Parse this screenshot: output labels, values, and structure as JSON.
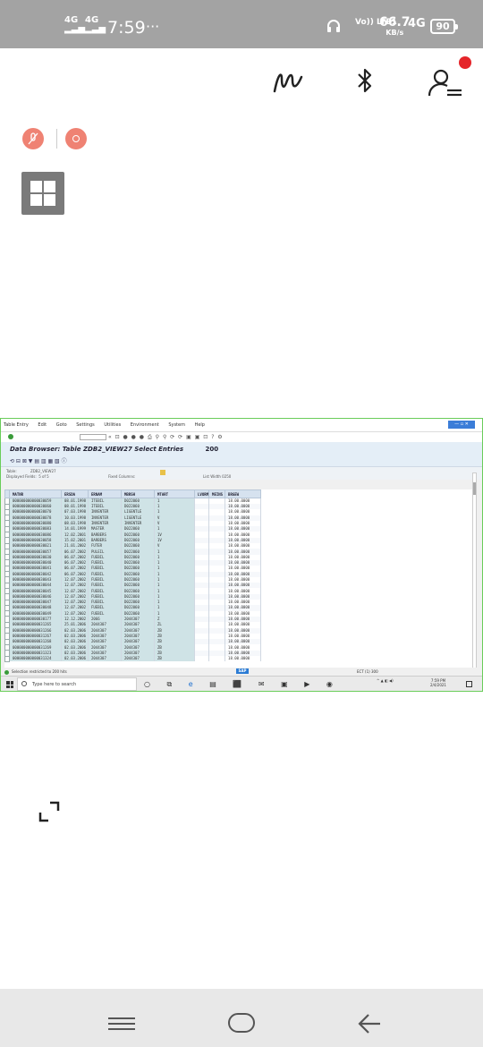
{
  "status_bar": {
    "network_1": "4G",
    "network_2": "4G",
    "time": "7:59",
    "more": "···",
    "volte": "Vo)) LTE1",
    "speed_value": "66.7",
    "speed_unit": "KB/s",
    "network_3": "4G",
    "battery": "90"
  },
  "top_icons": {
    "draw": "signature-icon",
    "bluetooth": "bluetooth-icon",
    "profile": "profile-menu-icon",
    "notification_dot_color": "#e5252a"
  },
  "recorder": {
    "mic_off": "mic-off-icon",
    "record": "record-icon",
    "color": "#ef8273"
  },
  "sap": {
    "menu": [
      "Table Entry",
      "Edit",
      "Goto",
      "Settings",
      "Utilities",
      "Environment",
      "System",
      "Help"
    ],
    "title": "Data Browser: Table ZDB2_VIEW27 Select Entries",
    "entries": "200",
    "info": {
      "table_label": "Table:",
      "table_value": "ZDB2_VIEW27",
      "displayed_label": "Displayed Fields:",
      "displayed_value": "5 of 5",
      "fixed_label": "Fixed Columns:",
      "width_label": "List Width 0250"
    },
    "columns": [
      "MATNR",
      "ERSDA",
      "ERNAM",
      "MBRSH",
      "MTART",
      "LVORM",
      "MEINS",
      "BRGEW"
    ],
    "rows": [
      [
        "000000000000030059",
        "08.01.1998",
        "ITEBIL",
        "D022060",
        "1",
        "",
        "",
        "18.00.0000"
      ],
      [
        "000000000000030060",
        "08.01.1998",
        "ITEBIL",
        "D022060",
        "1",
        "",
        "",
        "18.00.0000"
      ],
      [
        "000000000000030070",
        "07.03.1998",
        "INVENTER",
        "LIGENTLE",
        "1",
        "",
        "",
        "18.00.0000"
      ],
      [
        "000000000000030078",
        "10.03.1998",
        "INVENTER",
        "LIGENTLE",
        "V",
        "",
        "",
        "18.00.0000"
      ],
      [
        "000000000000030080",
        "08.03.1998",
        "INVENTER",
        "INVENTER",
        "V",
        "",
        "",
        "18.00.0000"
      ],
      [
        "000000000000030083",
        "14.01.1999",
        "MASTER",
        "D022060",
        "1",
        "",
        "",
        "18.00.0000"
      ],
      [
        "000000000000030086",
        "12.02.2001",
        "BARBERS",
        "D022060",
        "1V",
        "",
        "",
        "18.00.0000"
      ],
      [
        "000000000000030058",
        "15.02.2001",
        "BARBERS",
        "D022060",
        "1V",
        "",
        "",
        "18.00.0000"
      ],
      [
        "000000000000030021",
        "21.01.2002",
        "FUTER",
        "D022060",
        "V",
        "",
        "",
        "18.00.0000"
      ],
      [
        "000000000000030057",
        "06.07.2002",
        "PULEIL",
        "D022060",
        "1",
        "",
        "",
        "18.00.0000"
      ],
      [
        "000000000000030030",
        "06.07.2002",
        "FUEBIL",
        "D022060",
        "1",
        "",
        "",
        "18.00.0000"
      ],
      [
        "000000000000030040",
        "06.07.2002",
        "FUEBIL",
        "D022060",
        "1",
        "",
        "",
        "18.00.0000"
      ],
      [
        "000000000000030041",
        "06.07.2002",
        "FUEBIL",
        "D022060",
        "1",
        "",
        "",
        "18.00.0000"
      ],
      [
        "000000000000030042",
        "06.07.2002",
        "FUEBIL",
        "D022060",
        "1",
        "",
        "",
        "18.00.0000"
      ],
      [
        "000000000000030043",
        "12.07.2002",
        "FUEBIL",
        "D022060",
        "1",
        "",
        "",
        "18.00.0000"
      ],
      [
        "000000000000030044",
        "12.07.2002",
        "FUEBIL",
        "D022060",
        "1",
        "",
        "",
        "18.00.0000"
      ],
      [
        "000000000000030045",
        "12.07.2002",
        "FUEBIL",
        "D022060",
        "1",
        "",
        "",
        "18.00.0000"
      ],
      [
        "000000000000030046",
        "12.07.2002",
        "FUEBIL",
        "D022060",
        "1",
        "",
        "",
        "18.00.0000"
      ],
      [
        "000000000000030047",
        "12.07.2002",
        "FUEBIL",
        "D022060",
        "1",
        "",
        "",
        "18.00.0000"
      ],
      [
        "000000000000030048",
        "12.07.2002",
        "FUEBIL",
        "D022060",
        "1",
        "",
        "",
        "18.00.0000"
      ],
      [
        "000000000000030049",
        "12.07.2002",
        "FUEBIL",
        "D022060",
        "1",
        "",
        "",
        "18.00.0000"
      ],
      [
        "000000000000030177",
        "12.12.2002",
        "2066",
        "2044307",
        "Z",
        "",
        "",
        "18.00.0000"
      ],
      [
        "000000000000031265",
        "25.01.2006",
        "2044307",
        "2044307",
        "ZL",
        "",
        "",
        "18.00.0000"
      ],
      [
        "000000000000031266",
        "02.03.2006",
        "2044307",
        "2044307",
        "ZB",
        "",
        "",
        "18.00.0000"
      ],
      [
        "000000000000031267",
        "02.03.2006",
        "2044307",
        "2044307",
        "ZB",
        "",
        "",
        "18.00.0000"
      ],
      [
        "000000000000031268",
        "02.03.2006",
        "2044307",
        "2044307",
        "ZB",
        "",
        "",
        "18.00.0000"
      ],
      [
        "000000000000031269",
        "02.03.2006",
        "2044307",
        "2044307",
        "ZB",
        "",
        "",
        "18.00.0000"
      ],
      [
        "000000000000031323",
        "02.03.2006",
        "2044307",
        "2044307",
        "ZB",
        "",
        "",
        "18.00.0000"
      ],
      [
        "000000000000031324",
        "02.03.2006",
        "2044307",
        "2044307",
        "ZB",
        "",
        "",
        "18.00.0000"
      ]
    ],
    "status": "Selection restricted to 200 hits",
    "status_right": "ECT (1) 300",
    "taskbar_search": "Type here to search",
    "clock_time": "7:59 PM",
    "clock_date": "2/4/2021"
  },
  "crop_icon": "crop-corner-icon",
  "nav": {
    "menu": "recent-apps-icon",
    "home": "home-icon",
    "back": "back-arrow-icon"
  }
}
